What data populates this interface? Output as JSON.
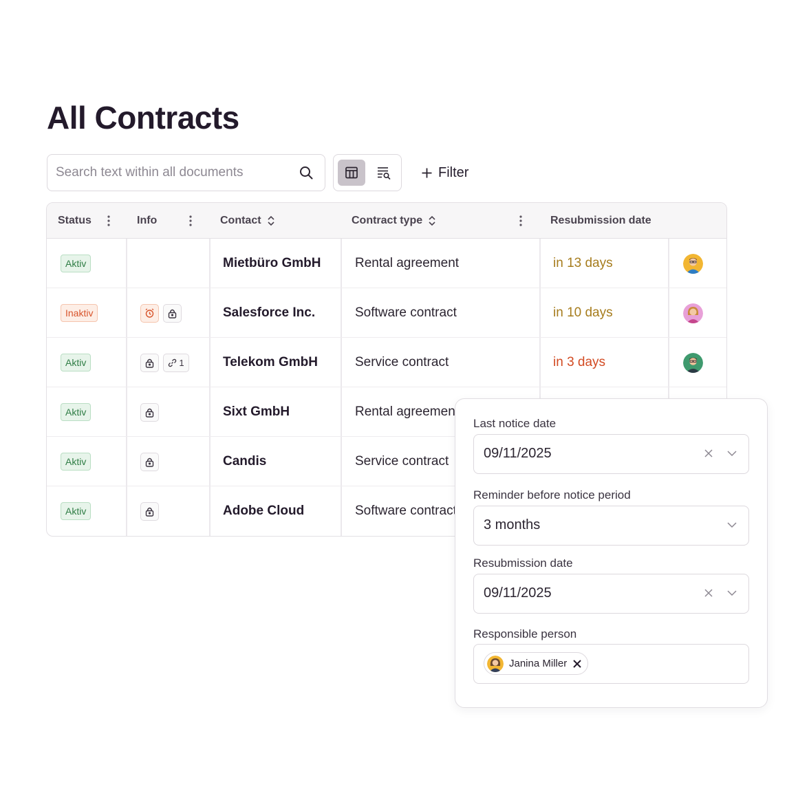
{
  "page": {
    "title": "All Contracts"
  },
  "search": {
    "placeholder": "Search text within all documents",
    "icon": "search-icon"
  },
  "view_toggle": {
    "options": [
      "table-view",
      "document-search-view"
    ],
    "active": "table-view"
  },
  "filter": {
    "label": "Filter",
    "icon": "plus-icon"
  },
  "table": {
    "columns": [
      "Status",
      "Info",
      "Contact",
      "Contract type",
      "Resubmission date"
    ],
    "rows": [
      {
        "status": "Aktiv",
        "status_type": "active",
        "info": [],
        "contact": "Mietbüro GmbH",
        "contract_type": "Rental agreement",
        "resubmission": "in 13 days",
        "resub_color": "#a67c1d",
        "avatar": "avatar-man-glasses-blue"
      },
      {
        "status": "Inaktiv",
        "status_type": "inactive",
        "info": [
          "alarm-icon",
          "lock-icon"
        ],
        "contact": "Salesforce Inc.",
        "contract_type": "Software contract",
        "resubmission": "in 10 days",
        "resub_color": "#a67c1d",
        "avatar": "avatar-woman-pink"
      },
      {
        "status": "Aktiv",
        "status_type": "active",
        "info": [
          "lock-icon",
          "link-icon"
        ],
        "link_count": "1",
        "contact": "Telekom GmbH",
        "contract_type": "Service contract",
        "resubmission": "in 3 days",
        "resub_color": "#d24a22",
        "avatar": "avatar-man-green"
      },
      {
        "status": "Aktiv",
        "status_type": "active",
        "info": [
          "lock-icon"
        ],
        "contact": "Sixt GmbH",
        "contract_type": "Rental agreement"
      },
      {
        "status": "Aktiv",
        "status_type": "active",
        "info": [
          "lock-icon"
        ],
        "contact": "Candis",
        "contract_type": "Service contract"
      },
      {
        "status": "Aktiv",
        "status_type": "active",
        "info": [
          "lock-icon"
        ],
        "contact": "Adobe Cloud",
        "contract_type": "Software contract"
      }
    ]
  },
  "popover": {
    "last_notice": {
      "label": "Last notice date",
      "value": "09/11/2025"
    },
    "reminder": {
      "label": "Reminder before notice period",
      "value": "3 months"
    },
    "resubmission": {
      "label": "Resubmission date",
      "value": "09/11/2025"
    },
    "responsible": {
      "label": "Responsible person",
      "chip": "Janina Miller"
    }
  },
  "colors": {
    "active_badge": "#2f7d45",
    "inactive_badge": "#d8542b",
    "accent_amber": "#a67c1d",
    "accent_red": "#d24a22"
  }
}
